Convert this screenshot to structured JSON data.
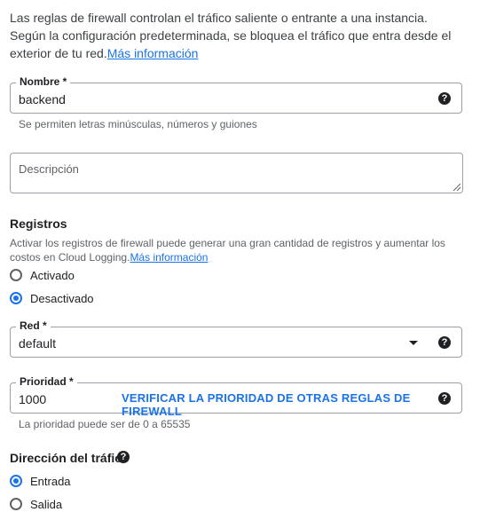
{
  "intro": {
    "text": "Las reglas de firewall controlan el tráfico saliente o entrante a una instancia. Según la configuración predeterminada, se bloquea el tráfico que entra desde el exterior de tu red.",
    "link": "Más información"
  },
  "name_field": {
    "label": "Nombre *",
    "value": "backend",
    "helper": "Se permiten letras minúsculas, números y guiones"
  },
  "description_field": {
    "placeholder": "Descripción"
  },
  "logs": {
    "title": "Registros",
    "description": "Activar los registros de firewall puede generar una gran cantidad de registros y aumentar los costos en Cloud Logging.",
    "link": "Más información",
    "options": [
      {
        "label": "Activado",
        "checked": false
      },
      {
        "label": "Desactivado",
        "checked": true
      }
    ]
  },
  "network_field": {
    "label": "Red *",
    "value": "default"
  },
  "priority_field": {
    "label": "Prioridad *",
    "value": "1000",
    "verify_button": "VERIFICAR LA PRIORIDAD DE OTRAS REGLAS DE FIREWALL",
    "helper": "La prioridad puede ser de 0 a 65535"
  },
  "direction": {
    "title": "Dirección del tráfico",
    "options": [
      {
        "label": "Entrada",
        "checked": true
      },
      {
        "label": "Salida",
        "checked": false
      }
    ]
  },
  "colors": {
    "accent": "#1a73e8",
    "text": "#202124",
    "secondary": "#5f6368",
    "border": "#9aa0a6"
  },
  "icons": {
    "help": "help-icon",
    "dropdown": "dropdown-arrow-icon"
  }
}
